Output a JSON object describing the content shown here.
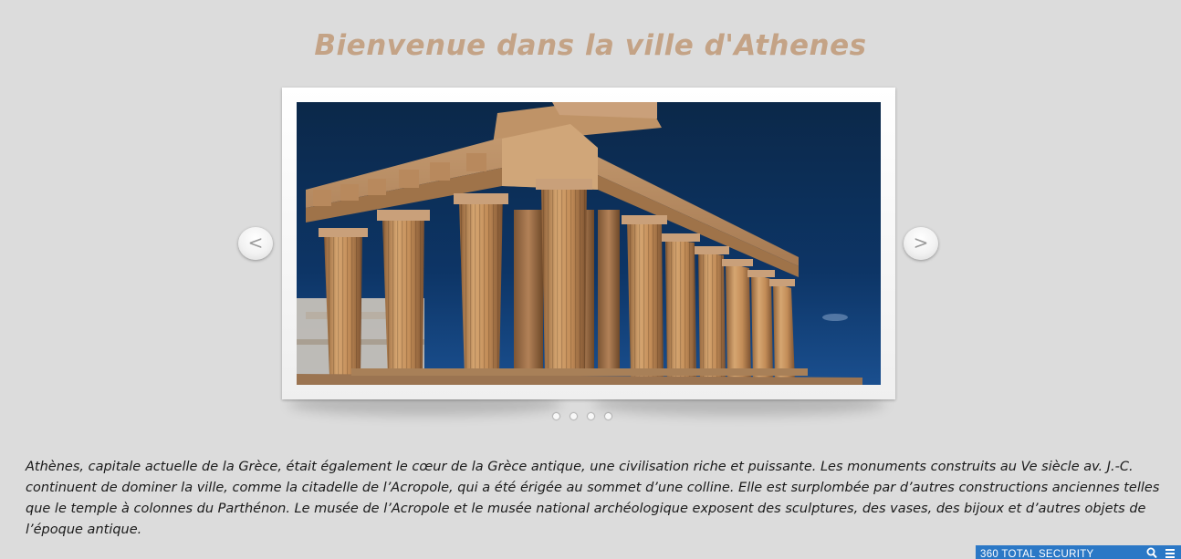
{
  "page": {
    "title": "Bienvenue dans la ville d'Athenes",
    "description": "Athènes, capitale actuelle de la Grèce, était également le cœur de la Grèce antique, une civilisation riche et puissante. Les monuments construits au Ve siècle av. J.-C. continuent de dominer la ville, comme la citadelle de l’Acropole, qui a été érigée au sommet d’une colline. Elle est surplombée par d’autres constructions anciennes telles que le temple à colonnes du Parthénon. Le musée de l’Acropole et le musée national archéologique exposent des sculptures, des vases, des bijoux et d’autres objets de l’époque antique."
  },
  "slider": {
    "prev_label": "<",
    "next_label": ">",
    "slide_count": 4,
    "current_slide": 1,
    "slides": [
      {
        "subject": "parthenon-temple-photo"
      }
    ]
  },
  "security_toolbar": {
    "label": "360 TOTAL SECURITY",
    "icons": [
      "search-icon",
      "menu-icon"
    ]
  },
  "colors": {
    "background": "#dcdcdc",
    "title": "#c4a386",
    "text": "#1a1a1a",
    "security_bar": "#2b78c6"
  }
}
